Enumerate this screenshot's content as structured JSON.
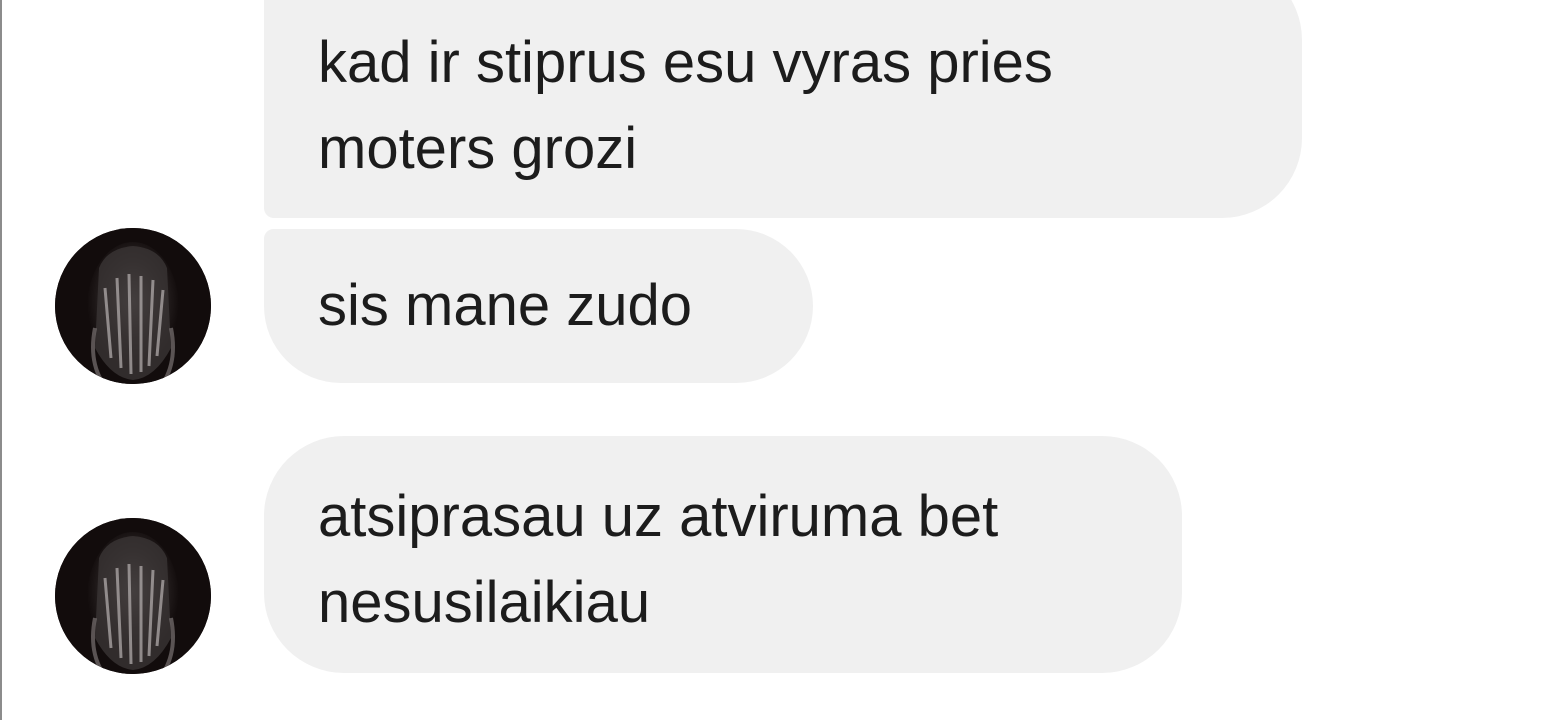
{
  "messages": [
    {
      "sender": "contact",
      "lines": [
        "kad ir stiprus esu vyras pries",
        "moters grozi"
      ]
    },
    {
      "sender": "contact",
      "lines": [
        "sis mane zudo"
      ],
      "avatar": "hands-over-face-photo"
    },
    {
      "sender": "contact",
      "lines": [
        "atsiprasau uz atviruma bet",
        "nesusilaikiau"
      ],
      "avatar": "hands-over-face-photo"
    }
  ],
  "colors": {
    "bubble_background": "#f0f0f0",
    "text": "#1c1c1c",
    "page_background": "#ffffff",
    "avatar_background": "#120c0c"
  }
}
